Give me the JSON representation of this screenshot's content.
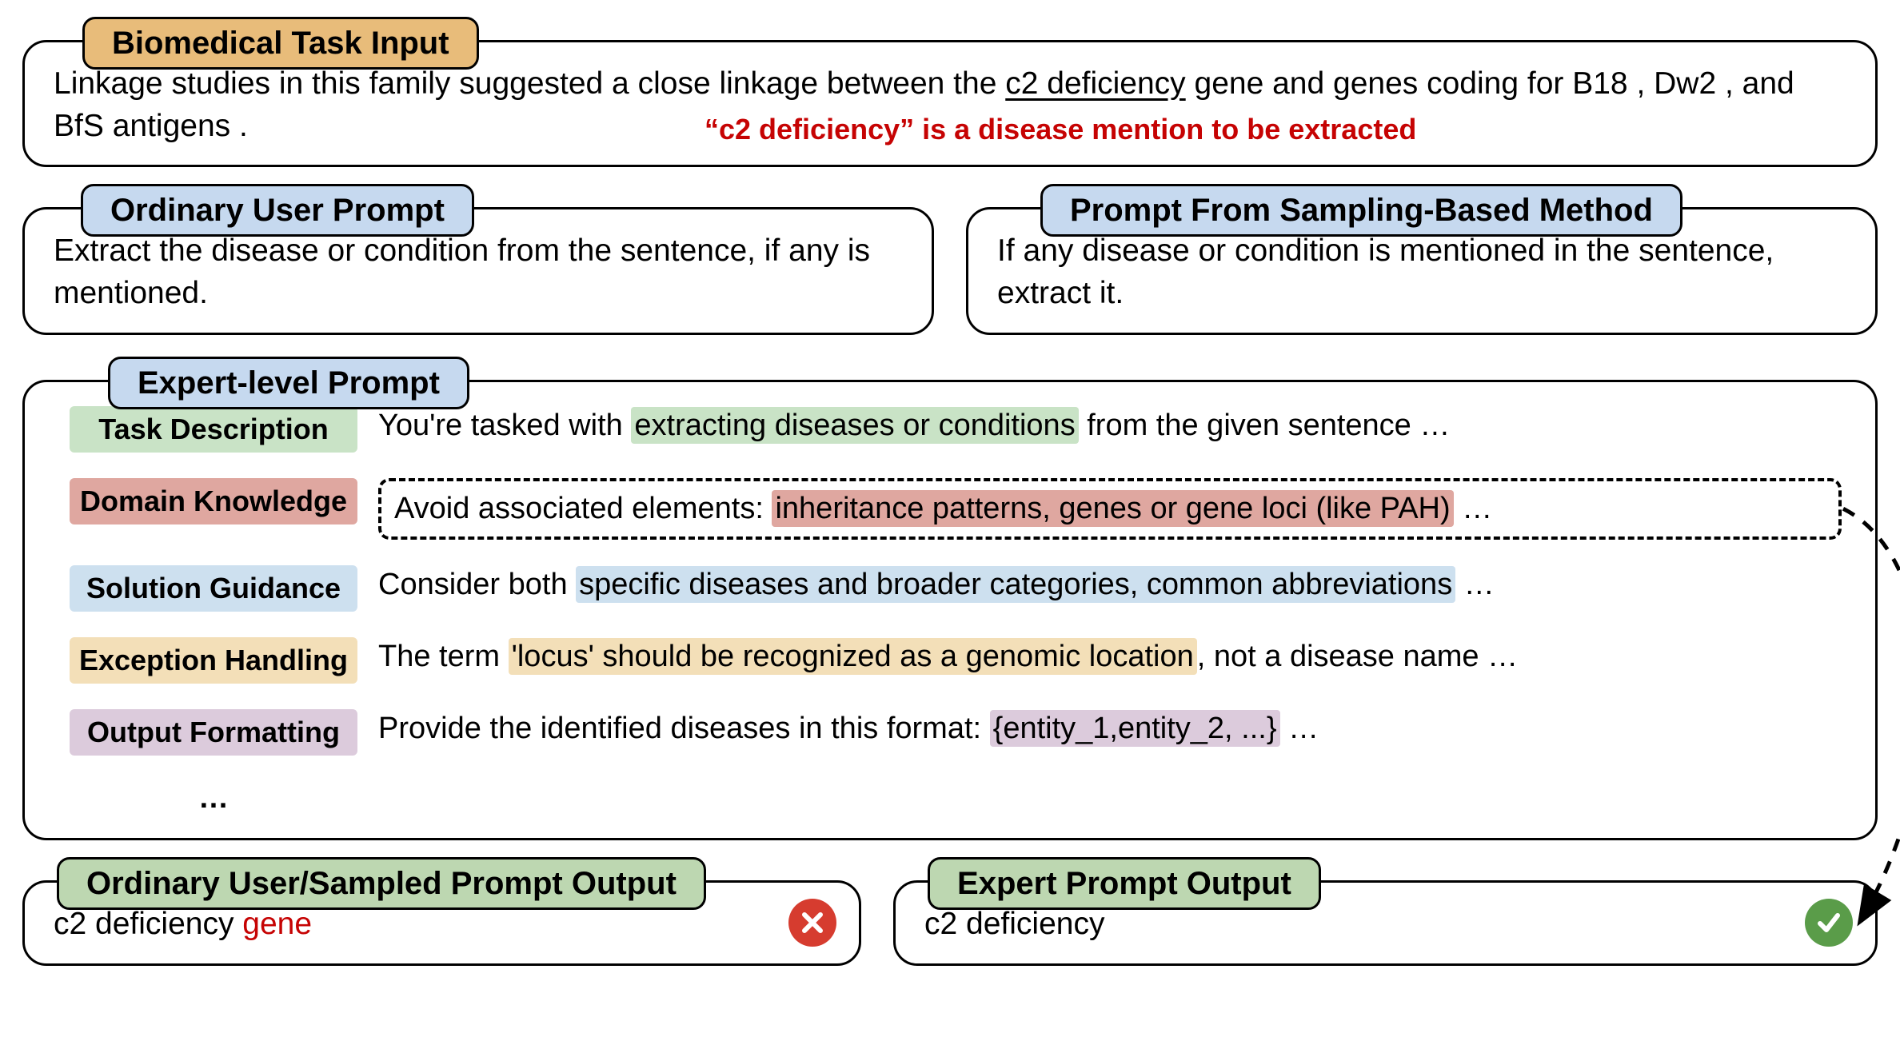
{
  "input": {
    "title": "Biomedical Task Input",
    "text_pre": "Linkage studies in this family suggested a close linkage between the ",
    "underlined": "c2 deficiency",
    "text_post": " gene and genes coding for B18 , Dw2 , and BfS antigens .",
    "note": "“c2 deficiency” is a disease mention to be extracted"
  },
  "ordinary": {
    "title": "Ordinary User Prompt",
    "text": "Extract the disease or condition from the sentence, if any is mentioned."
  },
  "sampled": {
    "title": "Prompt From Sampling-Based Method",
    "text": "If any disease or condition is mentioned in the sentence, extract it."
  },
  "expert": {
    "title": "Expert-level Prompt",
    "rows": [
      {
        "label": "Task Description",
        "pre": "You're tasked with ",
        "hl": "extracting diseases or conditions",
        "post": " from the given sentence …"
      },
      {
        "label": "Domain Knowledge",
        "pre": "Avoid associated elements: ",
        "hl": "inheritance patterns, genes or gene loci (like PAH)",
        "post": " …",
        "dashed": true
      },
      {
        "label": "Solution Guidance",
        "pre": "Consider both ",
        "hl": "specific diseases and broader categories, common abbreviations",
        "post": " …"
      },
      {
        "label": "Exception Handling",
        "pre": "The term ",
        "hl": "'locus' should be recognized as a genomic location",
        "post": ", not a disease name …"
      },
      {
        "label": "Output Formatting",
        "pre": "Provide the identified diseases in this format: ",
        "hl": "{entity_1,entity_2, ...}",
        "post": " …"
      }
    ],
    "ellipsis": "…"
  },
  "outputs": {
    "ordinary": {
      "title": "Ordinary User/Sampled Prompt Output",
      "text_pre": "c2 deficiency ",
      "text_red": "gene",
      "icon": "cross"
    },
    "expert": {
      "title": "Expert Prompt Output",
      "text": "c2 deficiency",
      "icon": "check"
    }
  }
}
